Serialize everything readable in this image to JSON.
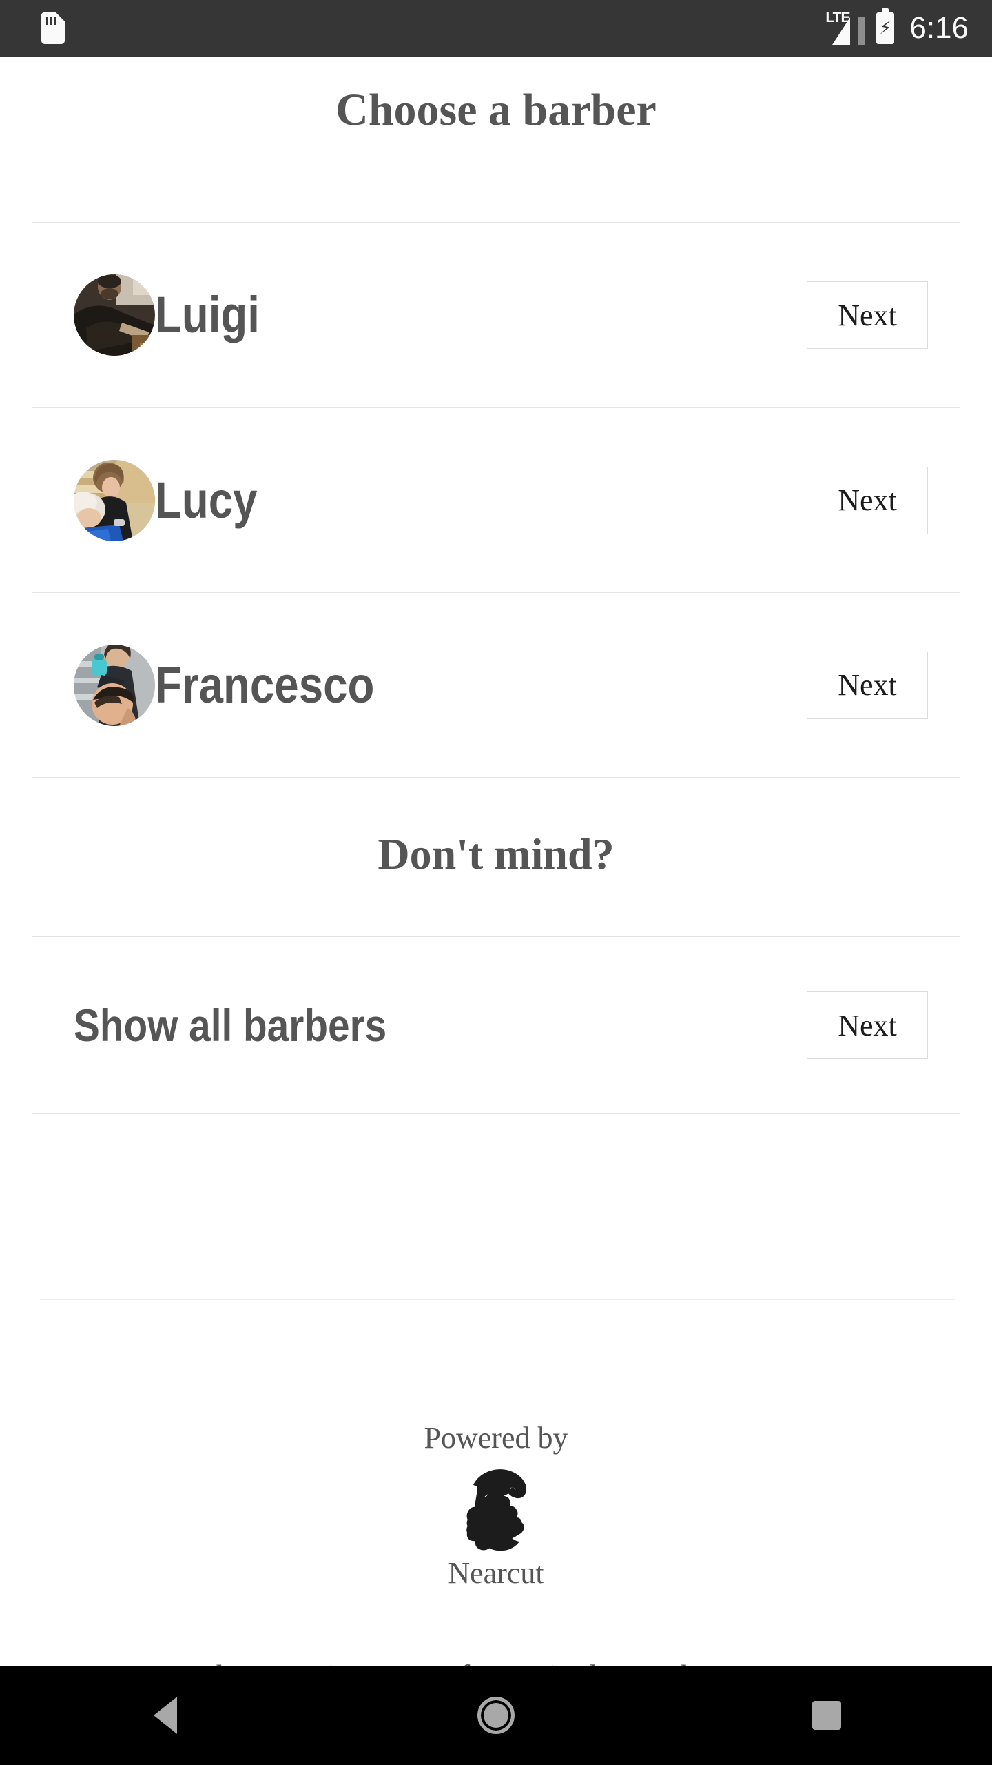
{
  "status_bar": {
    "sdcard_icon": "sd-card-icon",
    "network_label": "LTE",
    "battery_icon": "battery-charging-icon",
    "clock": "6:16",
    "background_color": "#363636",
    "foreground_color": "#fafafa"
  },
  "page": {
    "title": "Choose a barber",
    "subtitle": "Don't mind?",
    "text_color": "#555555",
    "background_color": "#ffffff"
  },
  "barbers": [
    {
      "name": "Luigi",
      "avatar": "barber-photo-luigi",
      "next_label": "Next"
    },
    {
      "name": "Lucy",
      "avatar": "barber-photo-lucy",
      "next_label": "Next"
    },
    {
      "name": "Francesco",
      "avatar": "barber-photo-francesco",
      "next_label": "Next"
    }
  ],
  "show_all": {
    "label": "Show all barbers",
    "next_label": "Next"
  },
  "footer": {
    "powered_by": "Powered by",
    "brand": "Nearcut",
    "logo_icon": "bearded-man-profile-logo",
    "tagline": "Barber appointment software in the UK by Nearcut"
  },
  "nav_bar": {
    "back_label": "Back",
    "home_label": "Home",
    "recents_label": "Recents",
    "background_color": "#000000",
    "icon_color": "#a8a8a8"
  }
}
